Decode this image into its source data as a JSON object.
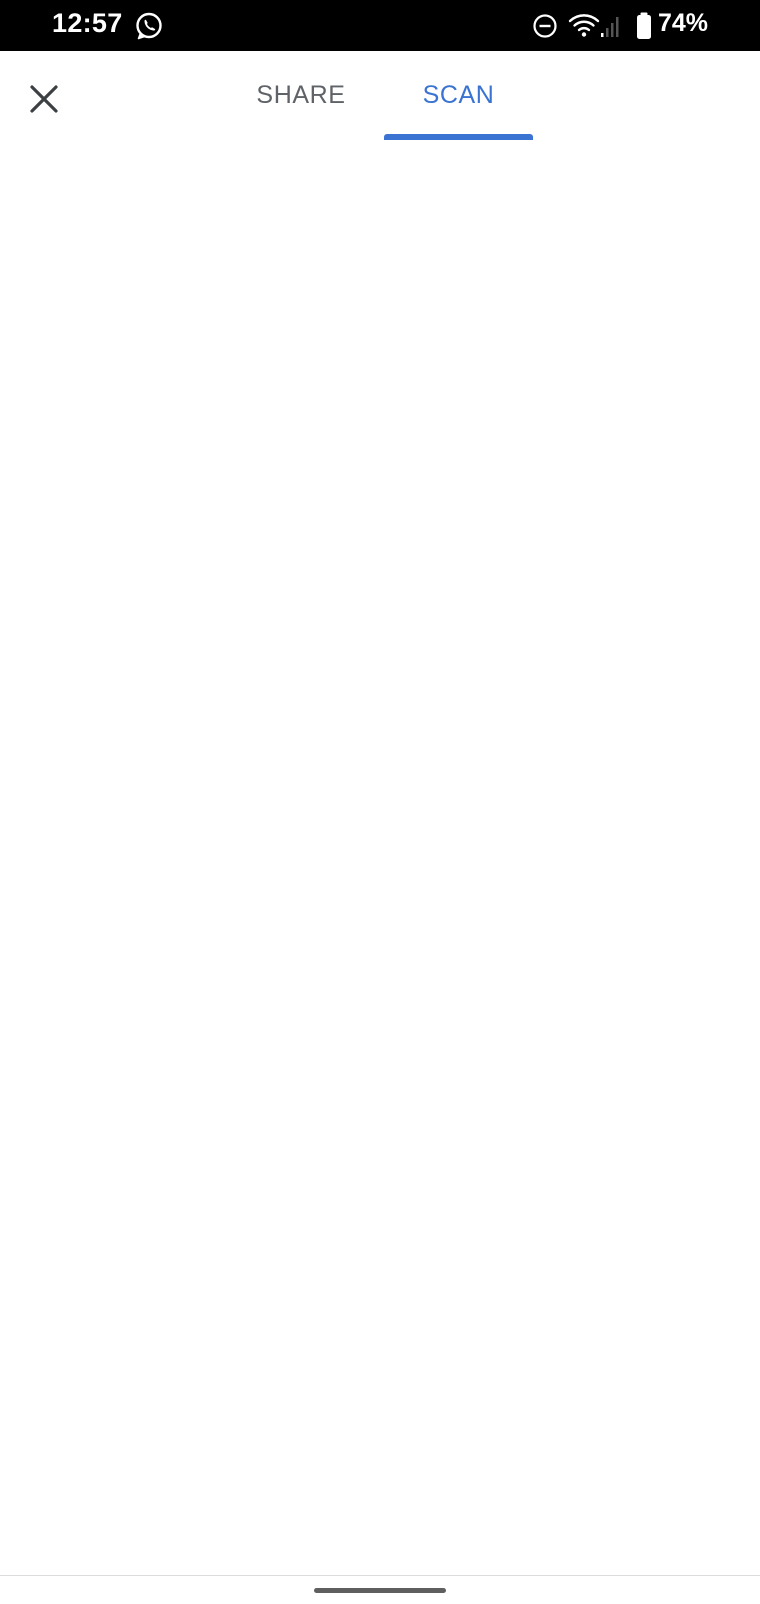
{
  "status_bar": {
    "time": "12:57",
    "battery_percent": "74%",
    "icons": [
      "whatsapp-icon",
      "do-not-disturb-icon",
      "wifi-icon",
      "cell-signal-icon",
      "battery-icon"
    ]
  },
  "app_bar": {
    "close_icon": "close-icon",
    "tabs": [
      {
        "label": "SHARE",
        "selected": false
      },
      {
        "label": "SCAN",
        "selected": true
      }
    ]
  },
  "colors": {
    "accent": "#3a73d1",
    "tab_inactive": "#5f6368",
    "status_bar_bg": "#000000",
    "background": "#ffffff"
  }
}
